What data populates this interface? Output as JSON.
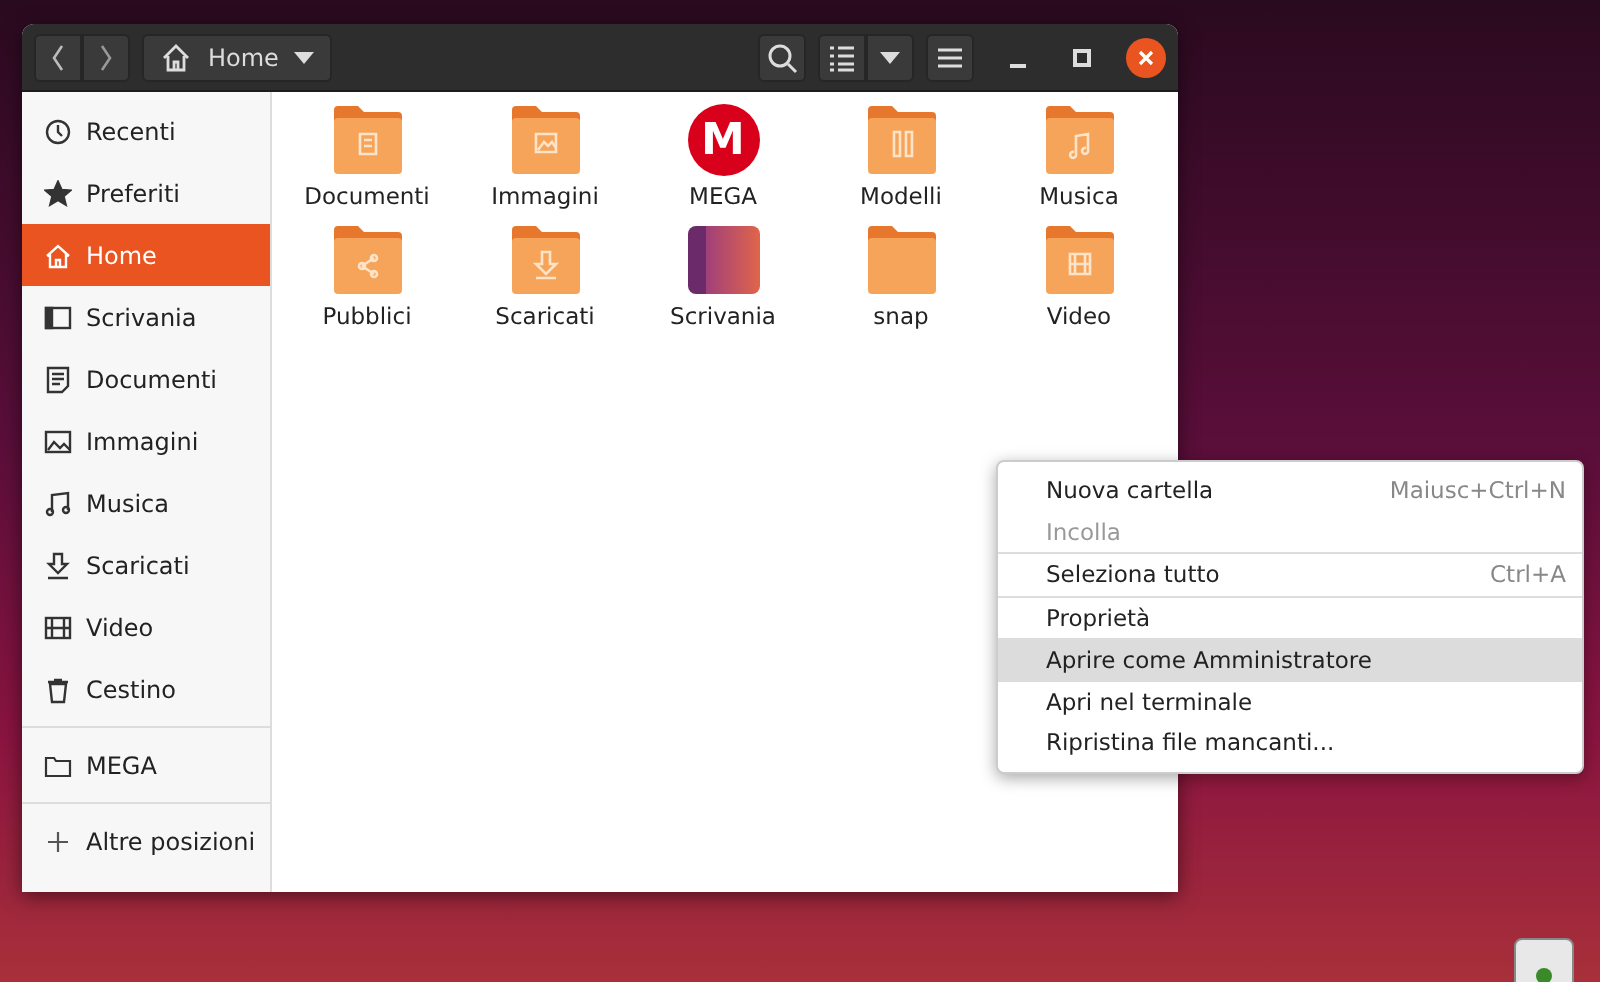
{
  "window": {
    "location": "Home"
  },
  "sidebar": {
    "items": [
      {
        "label": "Recenti",
        "selected": false
      },
      {
        "label": "Preferiti",
        "selected": false
      },
      {
        "label": "Home",
        "selected": true
      },
      {
        "label": "Scrivania",
        "selected": false
      },
      {
        "label": "Documenti",
        "selected": false
      },
      {
        "label": "Immagini",
        "selected": false
      },
      {
        "label": "Musica",
        "selected": false
      },
      {
        "label": "Scaricati",
        "selected": false
      },
      {
        "label": "Video",
        "selected": false
      },
      {
        "label": "Cestino",
        "selected": false
      }
    ],
    "devices": [
      {
        "label": "MEGA",
        "selected": false
      }
    ],
    "other": {
      "label": "Altre posizioni"
    }
  },
  "files": [
    {
      "name": "Documenti",
      "kind": "folder"
    },
    {
      "name": "Immagini",
      "kind": "folder"
    },
    {
      "name": "MEGA",
      "kind": "logo",
      "logo_text": "M"
    },
    {
      "name": "Modelli",
      "kind": "folder"
    },
    {
      "name": "Musica",
      "kind": "folder"
    },
    {
      "name": "Pubblici",
      "kind": "folder"
    },
    {
      "name": "Scaricati",
      "kind": "folder"
    },
    {
      "name": "Scrivania",
      "kind": "desktop"
    },
    {
      "name": "snap",
      "kind": "folder"
    },
    {
      "name": "Video",
      "kind": "folder"
    }
  ],
  "context_menu": [
    {
      "label": "Nuova cartella",
      "shortcut": "Maiusc+Ctrl+N",
      "disabled": false,
      "selected": false,
      "divider_after": false
    },
    {
      "label": "Incolla",
      "disabled": true,
      "selected": false,
      "divider_after": true
    },
    {
      "label": "Seleziona tutto",
      "shortcut": "Ctrl+A",
      "disabled": false,
      "selected": false,
      "divider_after": true
    },
    {
      "label": "Proprietà",
      "disabled": false,
      "selected": false,
      "divider_after": true
    },
    {
      "label": "Aprire come Amministratore",
      "disabled": false,
      "selected": true,
      "divider_after": false
    },
    {
      "label": "Apri nel terminale",
      "disabled": false,
      "selected": false,
      "divider_after": false
    },
    {
      "label": "Ripristina file mancanti...",
      "disabled": false,
      "selected": false,
      "divider_after": false
    }
  ]
}
